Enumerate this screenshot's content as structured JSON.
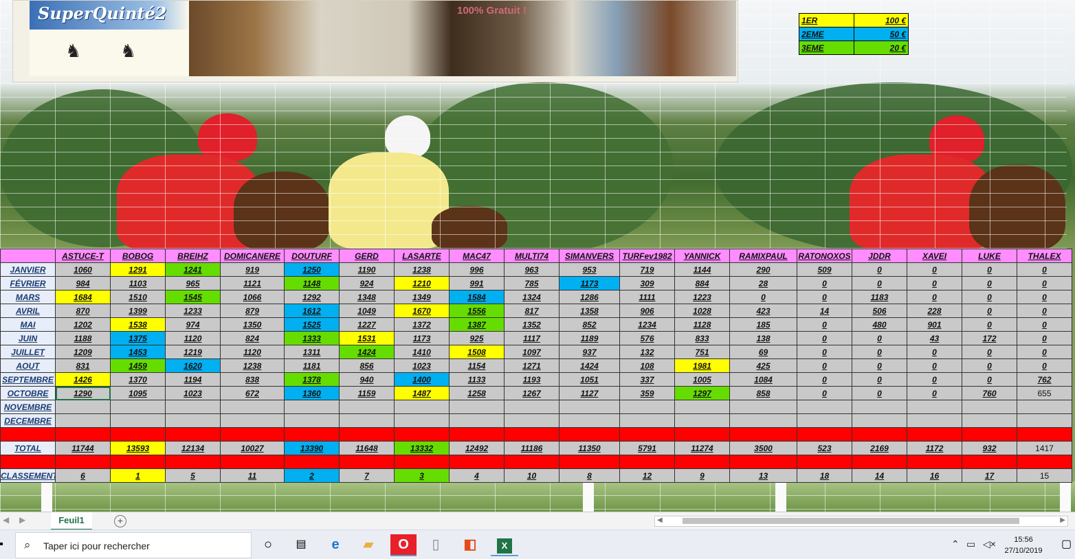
{
  "banner": {
    "logo_text": "SuperQuinté2",
    "tagline": "100% Gratuit !"
  },
  "prizes": [
    {
      "rank": "1ER",
      "amount": "100 €",
      "color": "#ffff00"
    },
    {
      "rank": "2EME",
      "amount": "50 €",
      "color": "#00b0f0"
    },
    {
      "rank": "3EME",
      "amount": "20 €",
      "color": "#66dd00"
    }
  ],
  "players": [
    "ASTUCE-T",
    "BOBOG",
    "BREIHZ",
    "DOMICANERE",
    "DOUTURF",
    "GERD",
    "LASARTE",
    "MAC47",
    "MULTI74",
    "SIMANVERS",
    "TURFev1982",
    "YANNICK",
    "RAMIXPAUL",
    "RATONOXOS",
    "JDDR",
    "XAVEI",
    "LUKE",
    "THALEX"
  ],
  "months": [
    {
      "name": "JANVIER",
      "values": [
        "1060",
        "1291",
        "1241",
        "919",
        "1250",
        "1190",
        "1238",
        "996",
        "963",
        "953",
        "719",
        "1144",
        "290",
        "509",
        "0",
        "0",
        "0",
        "0"
      ]
    },
    {
      "name": "FÉVRIER",
      "values": [
        "984",
        "1103",
        "965",
        "1121",
        "1148",
        "924",
        "1210",
        "991",
        "785",
        "1173",
        "309",
        "884",
        "28",
        "0",
        "0",
        "0",
        "0",
        "0"
      ]
    },
    {
      "name": "MARS",
      "values": [
        "1684",
        "1510",
        "1545",
        "1066",
        "1292",
        "1348",
        "1349",
        "1584",
        "1324",
        "1286",
        "1111",
        "1223",
        "0",
        "0",
        "1183",
        "0",
        "0",
        "0"
      ]
    },
    {
      "name": "AVRIL",
      "values": [
        "870",
        "1399",
        "1233",
        "879",
        "1612",
        "1049",
        "1670",
        "1556",
        "817",
        "1358",
        "906",
        "1028",
        "423",
        "14",
        "506",
        "228",
        "0",
        "0"
      ]
    },
    {
      "name": "MAI",
      "values": [
        "1202",
        "1538",
        "974",
        "1350",
        "1525",
        "1227",
        "1372",
        "1387",
        "1352",
        "852",
        "1234",
        "1128",
        "185",
        "0",
        "480",
        "901",
        "0",
        "0"
      ]
    },
    {
      "name": "JUIN",
      "values": [
        "1188",
        "1375",
        "1120",
        "824",
        "1333",
        "1531",
        "1173",
        "925",
        "1117",
        "1189",
        "576",
        "833",
        "138",
        "0",
        "0",
        "43",
        "172",
        "0"
      ]
    },
    {
      "name": "JUILLET",
      "values": [
        "1209",
        "1453",
        "1219",
        "1120",
        "1311",
        "1424",
        "1410",
        "1508",
        "1097",
        "937",
        "132",
        "751",
        "69",
        "0",
        "0",
        "0",
        "0",
        "0"
      ]
    },
    {
      "name": "AOUT",
      "values": [
        "831",
        "1459",
        "1620",
        "1238",
        "1181",
        "856",
        "1023",
        "1154",
        "1271",
        "1424",
        "108",
        "1981",
        "425",
        "0",
        "0",
        "0",
        "0",
        "0"
      ]
    },
    {
      "name": "SEPTEMBRE",
      "values": [
        "1426",
        "1370",
        "1194",
        "838",
        "1378",
        "940",
        "1400",
        "1133",
        "1193",
        "1051",
        "337",
        "1005",
        "1084",
        "0",
        "0",
        "0",
        "0",
        "762"
      ]
    },
    {
      "name": "OCTOBRE",
      "values": [
        "1290",
        "1095",
        "1023",
        "672",
        "1360",
        "1159",
        "1487",
        "1258",
        "1267",
        "1127",
        "359",
        "1297",
        "858",
        "0",
        "0",
        "0",
        "760",
        "655"
      ]
    },
    {
      "name": "NOVEMBRE",
      "values": [
        "",
        "",
        "",
        "",
        "",
        "",
        "",
        "",
        "",
        "",
        "",
        "",
        "",
        "",
        "",
        "",
        "",
        ""
      ]
    },
    {
      "name": "DECEMBRE",
      "values": [
        "",
        "",
        "",
        "",
        "",
        "",
        "",
        "",
        "",
        "",
        "",
        "",
        "",
        "",
        "",
        "",
        "",
        ""
      ]
    }
  ],
  "highlights": {
    "JANVIER": {
      "1": "yellow",
      "2": "green",
      "4": "blue"
    },
    "FÉVRIER": {
      "4": "green",
      "6": "yellow",
      "9": "blue"
    },
    "MARS": {
      "0": "yellow",
      "2": "green",
      "7": "blue"
    },
    "AVRIL": {
      "4": "blue",
      "6": "yellow",
      "7": "green"
    },
    "MAI": {
      "1": "yellow",
      "4": "blue",
      "7": "green"
    },
    "JUIN": {
      "1": "blue",
      "4": "green",
      "5": "yellow"
    },
    "JUILLET": {
      "1": "blue",
      "5": "green",
      "7": "yellow"
    },
    "AOUT": {
      "1": "green",
      "2": "blue",
      "11": "yellow"
    },
    "SEPTEMBRE": {
      "0": "yellow",
      "4": "green",
      "6": "blue"
    },
    "OCTOBRE": {
      "4": "blue",
      "6": "yellow",
      "11": "green"
    }
  },
  "total": {
    "label": "TOTAL",
    "values": [
      "11744",
      "13593",
      "12134",
      "10027",
      "13390",
      "11648",
      "13332",
      "12492",
      "11186",
      "11350",
      "5791",
      "11274",
      "3500",
      "523",
      "2169",
      "1172",
      "932",
      "1417"
    ],
    "colors": {
      "1": "yellow",
      "4": "blue",
      "6": "green"
    }
  },
  "classement": {
    "label": "CLASSEMENT",
    "values": [
      "6",
      "1",
      "5",
      "11",
      "2",
      "7",
      "3",
      "4",
      "10",
      "8",
      "12",
      "9",
      "13",
      "18",
      "14",
      "16",
      "17",
      "15"
    ],
    "colors": {
      "1": "yellow",
      "4": "blue",
      "6": "green"
    }
  },
  "sheet_tab": "Feuil1",
  "taskbar": {
    "search_placeholder": "Taper ici pour rechercher",
    "time": "15:56",
    "date": "27/10/2019"
  }
}
